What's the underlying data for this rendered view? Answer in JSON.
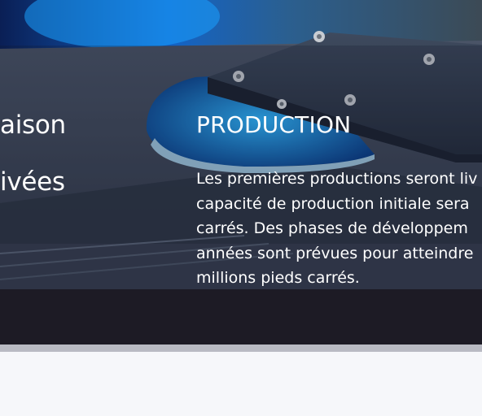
{
  "hero": {
    "side_heading_1": "aison",
    "side_heading_2": "ivées",
    "production": {
      "title": "PRODUCTION",
      "lines": [
        "Les premières productions seront liv",
        "capacité de production initiale sera",
        "carrés. Des phases de développem",
        "années sont prévues pour atteindre",
        "millions pieds carrés."
      ]
    },
    "background_image": "machine-platform-photo"
  },
  "colors": {
    "dark_band": "#1d1b25",
    "divider": "#b9bac3",
    "page_background": "#f6f7fa",
    "accent_blue": "#1e9fe0"
  }
}
